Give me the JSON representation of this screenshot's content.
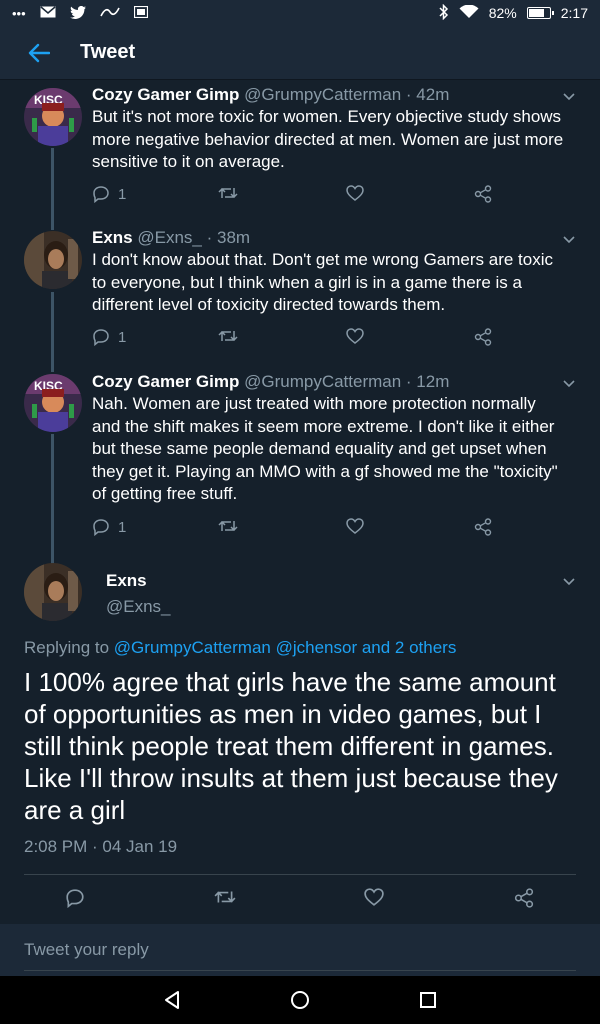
{
  "status_bar": {
    "left_icons": [
      "more-icon",
      "mail-icon",
      "twitter-icon",
      "photos-icon",
      "gallery-icon"
    ],
    "right_icons": [
      "bluetooth-icon",
      "wifi-icon"
    ],
    "battery": "82%",
    "battery_level": 0.82,
    "time": "2:17"
  },
  "app_bar": {
    "title": "Tweet",
    "back_icon": "arrow-left-icon",
    "accent": "#1da1f2"
  },
  "thread": [
    {
      "name": "Cozy Gamer Gimp",
      "handle": "@GrumpyCatterman",
      "time": "· 42m",
      "text": "But it's not more toxic for women. Every objective study shows more negative behavior directed at men. Women are just more sensitive to it on average.",
      "reply_count": "1"
    },
    {
      "name": "Exns",
      "handle": "@Exns_",
      "time": "· 38m",
      "text": "I don't know about that. Don't get me wrong Gamers are toxic to everyone, but I think when a girl is in a game there is a different level of toxicity directed towards them.",
      "reply_count": "1"
    },
    {
      "name": "Cozy Gamer Gimp",
      "handle": "@GrumpyCatterman",
      "time": "· 12m",
      "text": "Nah. Women are just treated with more protection normally and the shift makes it seem more extreme. I don't like it either but these same people demand equality and get upset when they get it. Playing an MMO with a gf showed me the \"toxicity\" of getting free stuff.",
      "reply_count": "1"
    }
  ],
  "main_tweet": {
    "name": "Exns",
    "handle": "@Exns_",
    "replying_prefix": "Replying to",
    "replying_to": "@GrumpyCatterman @jchensor and 2 others",
    "text": "I 100% agree that girls have the same amount of opportunities as men in video games, but I still think people treat them different in games. Like I'll throw insults at them just because they are a girl",
    "timestamp": "2:08 PM · 04 Jan 19"
  },
  "reply_bar": {
    "placeholder": "Tweet your reply"
  },
  "colors": {
    "background": "#15202b",
    "header": "#1c2938",
    "secondary_text": "#8899a6",
    "link": "#1da1f2"
  }
}
